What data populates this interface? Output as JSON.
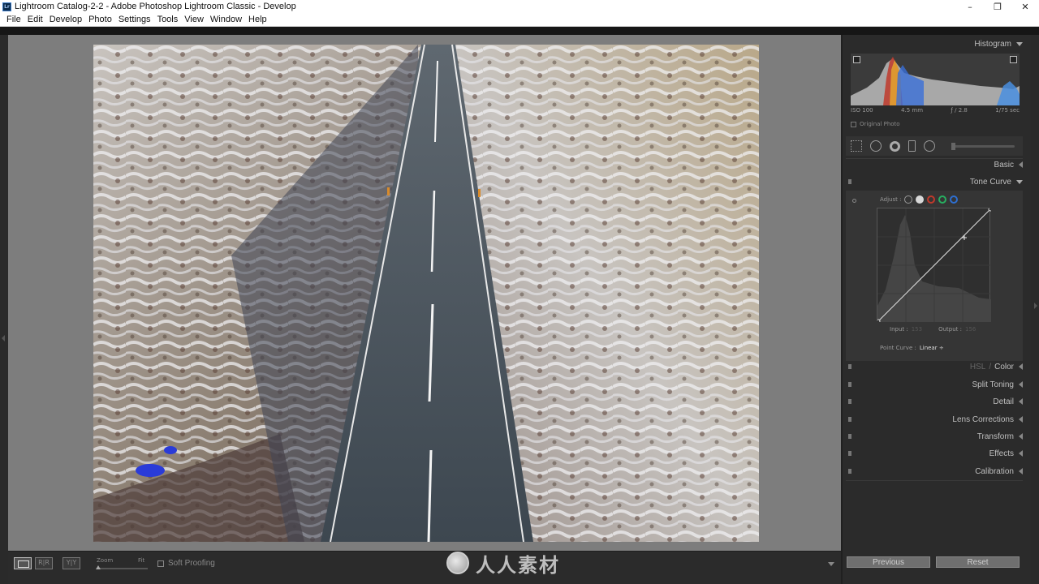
{
  "window": {
    "title": "Lightroom Catalog-2-2 - Adobe Photoshop Lightroom Classic - Develop",
    "minimize": "–",
    "maximize": "❐",
    "close": "✕"
  },
  "menu": [
    "File",
    "Edit",
    "Develop",
    "Photo",
    "Settings",
    "Tools",
    "View",
    "Window",
    "Help"
  ],
  "toolbar": {
    "zoom_label": "Zoom",
    "fit_label": "Fit",
    "soft_proofing": "Soft Proofing",
    "compare_glyph": "R|R",
    "survey_glyph": "Y|Y",
    "watermark_text": "人人素材"
  },
  "histogram": {
    "title": "Histogram",
    "iso": "ISO 100",
    "focal": "4.5 mm",
    "aperture": "ƒ / 2.8",
    "shutter": "1/75 sec",
    "original_photo": "Original Photo"
  },
  "panels": {
    "basic": "Basic",
    "tone_curve": "Tone Curve",
    "hsl_label": "HSL",
    "color_label": "Color",
    "split_toning": "Split Toning",
    "detail": "Detail",
    "lens_corrections": "Lens Corrections",
    "transform": "Transform",
    "effects": "Effects",
    "calibration": "Calibration"
  },
  "tone_curve": {
    "adjust_label": "Adjust :",
    "input_label": "Input :",
    "input_value": "153",
    "output_label": "Output :",
    "output_value": "156",
    "point_curve_label": "Point Curve :",
    "point_curve_value": "Linear ÷",
    "channel_colors": [
      "#d8d8d8",
      "#c0392b",
      "#27ae60",
      "#2e6fd1"
    ]
  },
  "footer": {
    "previous": "Previous",
    "reset": "Reset"
  },
  "accent": {
    "panel_bg": "#2b2b2b",
    "canvas_bg": "#7d7d7d",
    "button_bg": "#6f6f6f"
  }
}
